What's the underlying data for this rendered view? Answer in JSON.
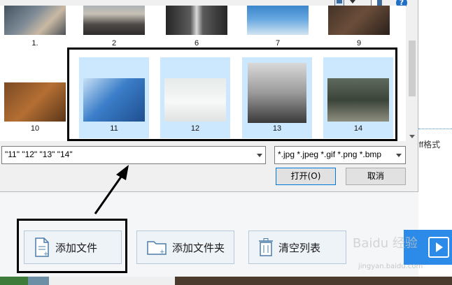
{
  "dialog": {
    "help_glyph": "?",
    "files": [
      {
        "label": "1.",
        "icon": "photo-hands-icon",
        "selected": false
      },
      {
        "label": "2",
        "icon": "photo-pier-icon",
        "selected": false
      },
      {
        "label": "6",
        "icon": "photo-room-icon",
        "selected": false
      },
      {
        "label": "7",
        "icon": "photo-city-icon",
        "selected": false
      },
      {
        "label": "9",
        "icon": "photo-desk-icon",
        "selected": false
      },
      {
        "label": "10",
        "icon": "photo-laptop-icon",
        "selected": false
      },
      {
        "label": "11",
        "icon": "photo-phone-icon",
        "selected": true
      },
      {
        "label": "12",
        "icon": "photo-plants-icon",
        "selected": true
      },
      {
        "label": "13",
        "icon": "photo-tower-icon",
        "selected": true
      },
      {
        "label": "14",
        "icon": "photo-road-icon",
        "selected": true
      }
    ],
    "filename_value": "\"11\" \"12\" \"13\" \"14\"",
    "filter_value": "*.jpg *.jpeg *.gif *.png *.bmp",
    "open_label": "打开(O)",
    "cancel_label": "取消"
  },
  "app": {
    "side_text": "iff格式",
    "add_file_label": "添加文件",
    "add_folder_label": "添加文件夹",
    "clear_label": "清空列表"
  },
  "watermark": {
    "text": "Baidu 经验",
    "url": "jingyan.baidu.com"
  },
  "colors": {
    "selection": "#cce8ff",
    "accent": "#2c8be8",
    "annotation": "#000000"
  }
}
